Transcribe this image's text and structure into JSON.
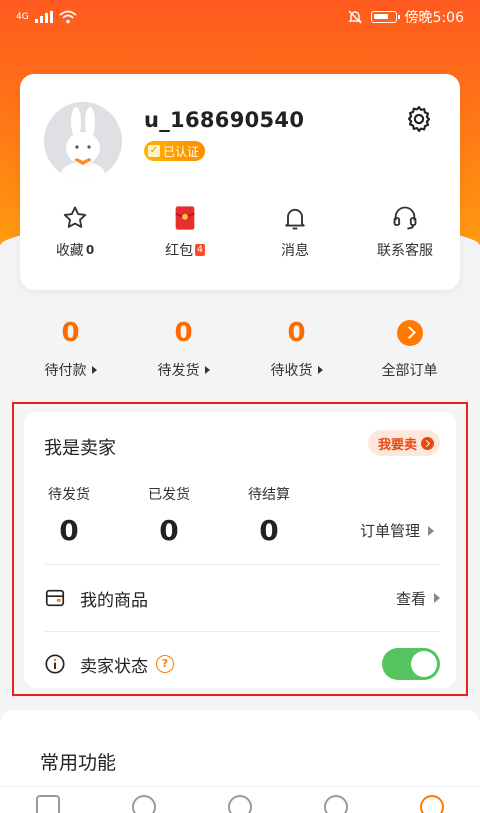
{
  "status_bar": {
    "network": "4G",
    "time_label": "傍晚5:06"
  },
  "profile": {
    "username": "u_168690540",
    "verified_label": "已认证",
    "quick_links": [
      {
        "label": "收藏",
        "count": "0",
        "icon": "star-icon"
      },
      {
        "label": "红包",
        "count": "4",
        "icon": "red-envelope-icon"
      },
      {
        "label": "消息",
        "count": "",
        "icon": "bell-icon"
      },
      {
        "label": "联系客服",
        "count": "",
        "icon": "headset-icon"
      }
    ]
  },
  "orders": [
    {
      "value": "0",
      "label": "待付款"
    },
    {
      "value": "0",
      "label": "待发货"
    },
    {
      "value": "0",
      "label": "待收货"
    },
    {
      "value": "",
      "label": "全部订单"
    }
  ],
  "seller": {
    "title": "我是卖家",
    "sell_button": "我要卖",
    "stats": [
      {
        "label": "待发货",
        "value": "0"
      },
      {
        "label": "已发货",
        "value": "0"
      },
      {
        "label": "待结算",
        "value": "0"
      }
    ],
    "order_management": "订单管理",
    "my_products": {
      "label": "我的商品",
      "action": "查看"
    },
    "seller_status": {
      "label": "卖家状态",
      "help": "?",
      "enabled": true
    }
  },
  "common": {
    "title": "常用功能"
  },
  "colors": {
    "brand_orange": "#ff7a00",
    "highlight_red": "#e8221a",
    "toggle_green": "#55c45e"
  }
}
